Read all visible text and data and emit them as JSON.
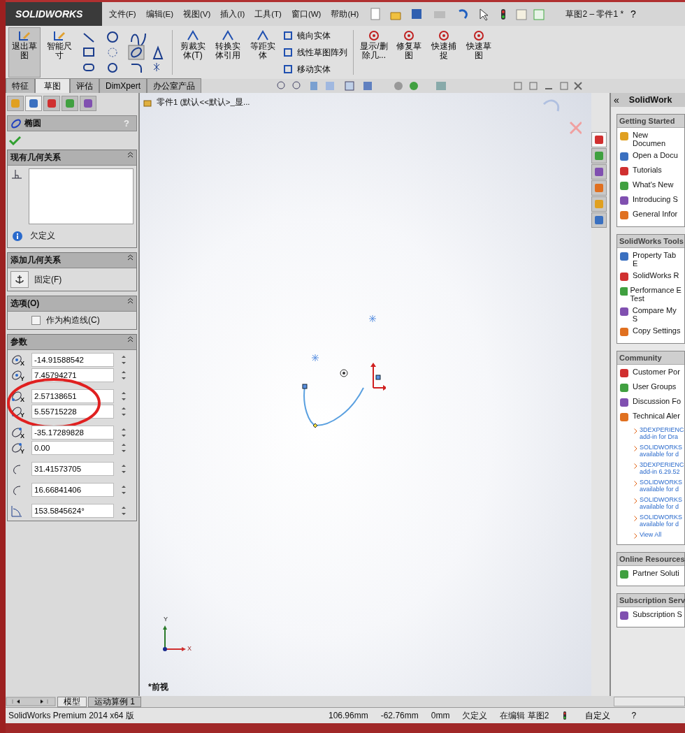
{
  "menu": {
    "logo": "SOLIDWORKS",
    "items": [
      "文件(F)",
      "编辑(E)",
      "视图(V)",
      "插入(I)",
      "工具(T)",
      "窗口(W)",
      "帮助(H)"
    ],
    "doc_title": "草图2 – 零件1 *",
    "help": "?"
  },
  "ribbon": {
    "first": [
      {
        "label": "退出草图",
        "selected": true
      },
      {
        "label": "智能尺寸",
        "selected": false
      }
    ],
    "second": [
      {
        "label": "剪裁实体(T)"
      },
      {
        "label": "转换实体引用"
      },
      {
        "label": "等距实体"
      }
    ],
    "list": [
      "镜向实体",
      "线性草图阵列",
      "移动实体"
    ],
    "third": [
      {
        "label": "显示/删除几..."
      },
      {
        "label": "修复草图"
      },
      {
        "label": "快速捕捉"
      },
      {
        "label": "快速草图"
      }
    ]
  },
  "tabs": [
    {
      "label": "特征",
      "selected": false
    },
    {
      "label": "草图",
      "selected": true
    },
    {
      "label": "评估",
      "selected": false
    },
    {
      "label": "DimXpert",
      "selected": false
    },
    {
      "label": "办公室产品",
      "selected": false
    }
  ],
  "panel_tabs": [
    {
      "selected": false
    },
    {
      "selected": true
    },
    {
      "selected": false
    },
    {
      "selected": false
    },
    {
      "selected": false
    }
  ],
  "property_manager": {
    "title": "椭圆",
    "help": "?",
    "relations": {
      "title": "现有几何关系",
      "status": "欠定义"
    },
    "add_relations": {
      "title": "添加几何关系",
      "button": "固定(F)"
    },
    "options": {
      "title": "选项(O)",
      "checkbox": {
        "label": "作为构造线(C)",
        "checked": false
      }
    },
    "parameters": {
      "title": "参数",
      "groups": [
        {
          "highlighted": false,
          "fields": [
            {
              "kind": "center",
              "axis": "X",
              "value": "-14.91588542"
            },
            {
              "kind": "center",
              "axis": "Y",
              "value": "7.45794271"
            }
          ]
        },
        {
          "highlighted": true,
          "fields": [
            {
              "kind": "start",
              "axis": "X",
              "value": "2.57138651"
            },
            {
              "kind": "start",
              "axis": "Y",
              "value": "5.55715228"
            }
          ]
        },
        {
          "highlighted": false,
          "fields": [
            {
              "kind": "end",
              "axis": "X",
              "value": "-35.17289828"
            },
            {
              "kind": "end",
              "axis": "Y",
              "value": "0.00"
            }
          ]
        },
        {
          "highlighted": false,
          "fields": [
            {
              "kind": "major",
              "value": "31.41573705"
            }
          ]
        },
        {
          "highlighted": false,
          "fields": [
            {
              "kind": "minor",
              "value": "16.66841406"
            }
          ]
        },
        {
          "highlighted": false,
          "fields": [
            {
              "kind": "angle",
              "value": "153.5845624°"
            }
          ]
        }
      ]
    }
  },
  "canvas": {
    "tree_item": "零件1  (默认<<默认>_显...",
    "view_label": "*前视",
    "axis_y": "Y",
    "axis_x": "X"
  },
  "side_tabs": [
    {
      "selected": true
    },
    {
      "selected": false
    },
    {
      "selected": false
    },
    {
      "selected": false
    },
    {
      "selected": false
    },
    {
      "selected": false
    }
  ],
  "task_pane": {
    "collapse": "«",
    "title": "SolidWork",
    "sections": [
      {
        "title": "Getting Started",
        "items": [
          "New Documen",
          "Open a Docu",
          "Tutorials",
          "What's New",
          "Introducing S",
          "General Infor"
        ]
      },
      {
        "title": "SolidWorks Tools",
        "items": [
          "Property Tab E",
          "SolidWorks R",
          "Performance E Test",
          "Compare My S",
          "Copy Settings"
        ]
      },
      {
        "title": "Community",
        "items": [
          "Customer Por",
          "User Groups",
          "Discussion Fo",
          "Technical Aler"
        ],
        "links": [
          "3DEXPERIENC add-in for Dra",
          "SOLIDWORKS available for d",
          "3DEXPERIENC add-in 6.29.52",
          "SOLIDWORKS available for d",
          "SOLIDWORKS available for d",
          "SOLIDWORKS available for d",
          "View All"
        ]
      },
      {
        "title": "Online Resources",
        "items": [
          "Partner Soluti"
        ]
      },
      {
        "title": "Subscription Serv",
        "items": [
          "Subscription S"
        ]
      }
    ]
  },
  "bottom_tabs": [
    {
      "label": "模型",
      "selected": true
    },
    {
      "label": "运动算例 1",
      "selected": false
    }
  ],
  "status_bar": {
    "product": "SolidWorks Premium 2014 x64 版",
    "x": "106.96mm",
    "y": "-62.76mm",
    "z": "0mm",
    "state": "欠定义",
    "editing": "在编辑 草图2",
    "units": "自定义",
    "help": "?"
  }
}
